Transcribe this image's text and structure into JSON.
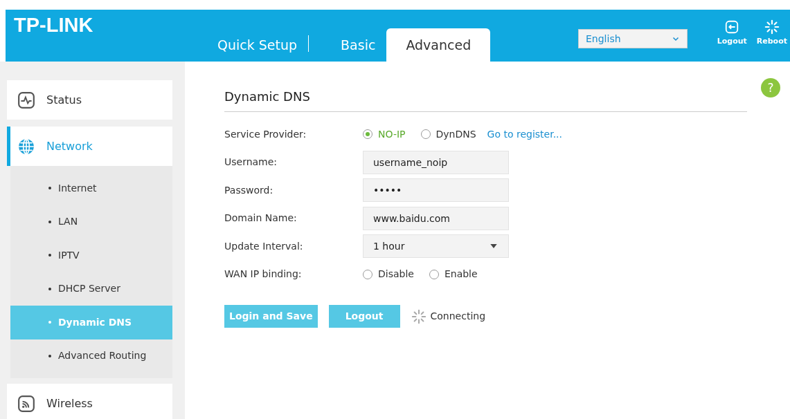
{
  "header": {
    "logo": "TP-LINK",
    "tabs": [
      {
        "label": "Quick Setup",
        "selected": false
      },
      {
        "label": "Basic",
        "selected": false
      },
      {
        "label": "Advanced",
        "selected": true
      }
    ],
    "language": "English",
    "actions": [
      {
        "kind": "logout",
        "label": "Logout"
      },
      {
        "kind": "reboot",
        "label": "Reboot"
      }
    ]
  },
  "sidebar": {
    "items": [
      {
        "kind": "status",
        "label": "Status",
        "selected": false
      },
      {
        "kind": "network",
        "label": "Network",
        "selected": true,
        "expanded": true,
        "children": [
          {
            "label": "Internet",
            "selected": false
          },
          {
            "label": "LAN",
            "selected": false
          },
          {
            "label": "IPTV",
            "selected": false
          },
          {
            "label": "DHCP Server",
            "selected": false
          },
          {
            "label": "Dynamic DNS",
            "selected": true
          },
          {
            "label": "Advanced Routing",
            "selected": false
          }
        ]
      },
      {
        "kind": "wireless",
        "label": "Wireless",
        "selected": false
      }
    ]
  },
  "form": {
    "title": "Dynamic DNS",
    "help": "?",
    "rows": [
      {
        "kind": "radio",
        "label": "Service Provider:",
        "options": [
          {
            "label": "NO-IP",
            "selected": true
          },
          {
            "label": "DynDNS",
            "selected": false
          }
        ],
        "link": "Go to register..."
      },
      {
        "kind": "text",
        "label": "Username:",
        "value": "username_noip"
      },
      {
        "kind": "text",
        "label": "Password:",
        "value": "•••••"
      },
      {
        "kind": "text",
        "label": "Domain Name:",
        "value": "www.baidu.com"
      },
      {
        "kind": "select",
        "label": "Update Interval:",
        "value": "1 hour"
      },
      {
        "kind": "radio",
        "label": "WAN IP binding:",
        "options": [
          {
            "label": "Disable",
            "selected": false
          },
          {
            "label": "Enable",
            "selected": false
          }
        ]
      }
    ],
    "buttons": [
      "Login and Save",
      "Logout"
    ],
    "status": "Connecting"
  }
}
